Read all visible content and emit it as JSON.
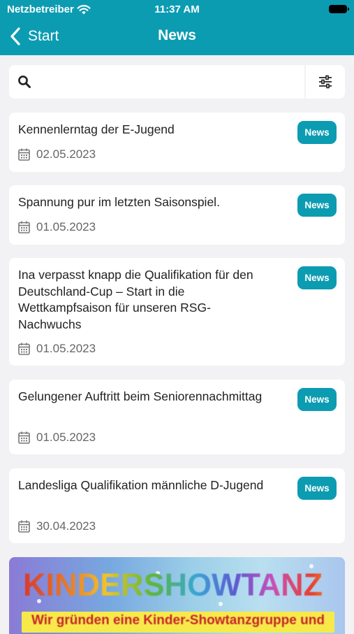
{
  "status_bar": {
    "carrier": "Netzbetreiber",
    "time": "11:37 AM"
  },
  "nav": {
    "back_label": "Start",
    "title": "News"
  },
  "search": {
    "value": "",
    "placeholder": ""
  },
  "news": [
    {
      "title": "Kennenlerntag der E-Jugend",
      "date": "02.05.2023",
      "badge": "News"
    },
    {
      "title": "Spannung pur im letzten Saisonspiel.",
      "date": "01.05.2023",
      "badge": "News"
    },
    {
      "title": "Ina verpasst knapp die Qualifikation für den Deutschland-Cup – Start in die Wettkampfsaison für unseren RSG-Nachwuchs",
      "date": "01.05.2023",
      "badge": "News"
    },
    {
      "title": "Gelungener Auftritt beim Seniorennachmittag",
      "date": "01.05.2023",
      "badge": "News"
    },
    {
      "title": "Landesliga Qualifikation männliche D-Jugend",
      "date": "30.04.2023",
      "badge": "News"
    }
  ],
  "banner": {
    "title": "KINDERSHOWTANZ",
    "subtitle": "Wir gründen eine Kinder-Showtanzgruppe und"
  },
  "colors": {
    "accent": "#0c9cb2",
    "background": "#f2f2f4",
    "card": "#ffffff"
  },
  "icons": {
    "back": "chevron-left-icon",
    "search": "search-icon",
    "filter": "sliders-icon",
    "date": "calendar-icon",
    "wifi": "wifi-icon",
    "battery": "battery-icon"
  }
}
